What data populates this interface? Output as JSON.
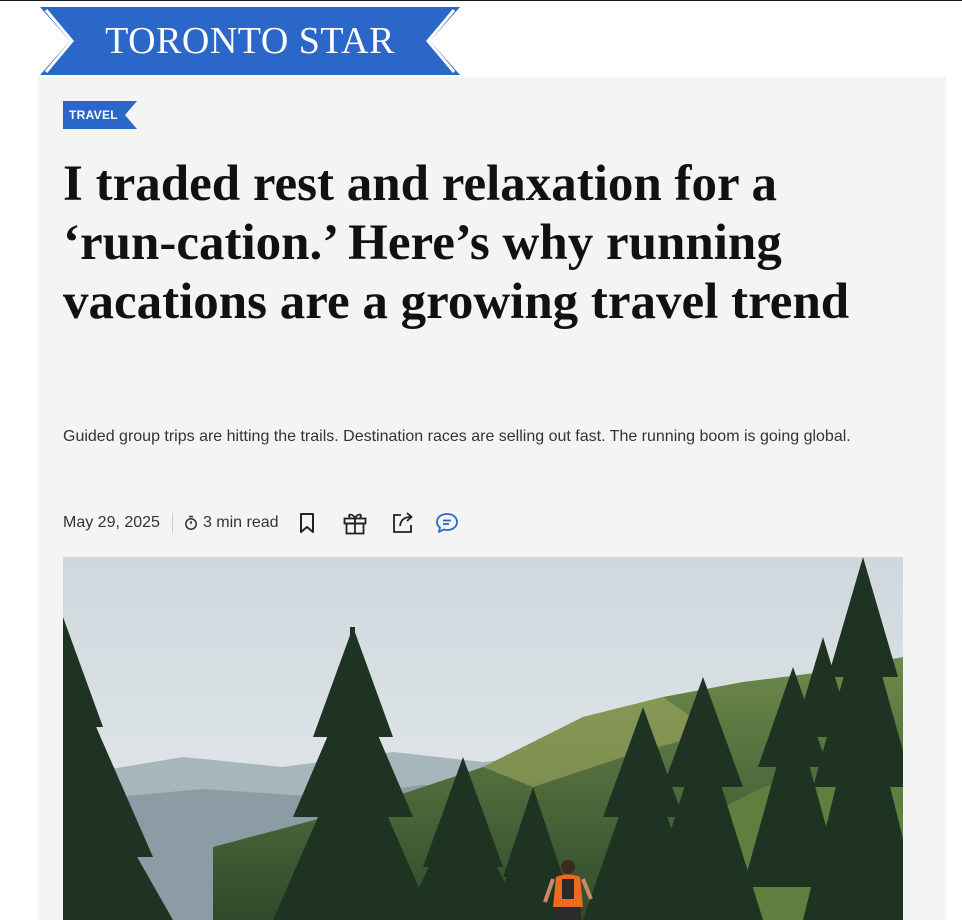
{
  "masthead": {
    "title": "TORONTO STAR"
  },
  "article": {
    "section_tag": "TRAVEL",
    "headline": "I traded rest and relaxation for a ‘run-cation.’ Here’s why running vacations are a growing travel trend",
    "dek": "Guided group trips are hitting the trails. Destination races are selling out fast. The running boom is going global.",
    "date": "May 29, 2025",
    "read_time": "3 min read"
  },
  "icons": {
    "timer": "stopwatch-icon",
    "bookmark": "bookmark-icon",
    "gift": "gift-icon",
    "share": "share-icon",
    "comment": "comment-icon"
  },
  "colors": {
    "brand_blue": "#2a67c9",
    "card_background": "#f4f4f4",
    "comment_blue": "#2a67c9"
  }
}
